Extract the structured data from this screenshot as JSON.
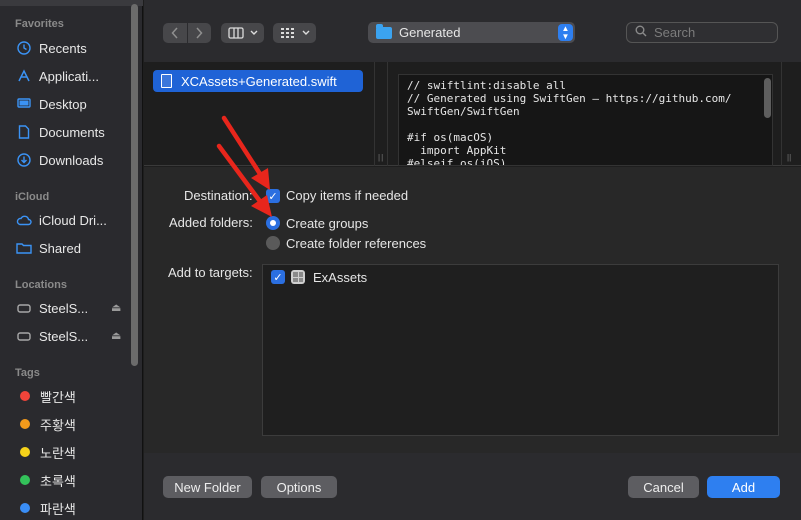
{
  "sidebar": {
    "sections": {
      "favorites": "Favorites",
      "icloud": "iCloud",
      "locations": "Locations",
      "tags": "Tags"
    },
    "favorites": [
      {
        "label": "Recents",
        "icon": "clock-icon"
      },
      {
        "label": "Applicati...",
        "icon": "applications-icon"
      },
      {
        "label": "Desktop",
        "icon": "desktop-icon"
      },
      {
        "label": "Documents",
        "icon": "document-icon"
      },
      {
        "label": "Downloads",
        "icon": "download-icon"
      }
    ],
    "icloud": [
      {
        "label": "iCloud Dri...",
        "icon": "cloud-icon"
      },
      {
        "label": "Shared",
        "icon": "shared-folder-icon"
      }
    ],
    "locations": [
      {
        "label": "SteelS...",
        "icon": "drive-icon"
      },
      {
        "label": "SteelS...",
        "icon": "drive-icon"
      }
    ],
    "tags": [
      {
        "label": "빨간색",
        "color": "#f0443a"
      },
      {
        "label": "주황색",
        "color": "#f39a1b"
      },
      {
        "label": "노란색",
        "color": "#f5d21a"
      },
      {
        "label": "초록색",
        "color": "#33c25a"
      },
      {
        "label": "파란색",
        "color": "#3a8ef6"
      }
    ]
  },
  "toolbar": {
    "path": "Generated",
    "search_placeholder": "Search"
  },
  "browser": {
    "selected_file": "XCAssets+Generated.swift",
    "preview_lines": [
      "// swiftlint:disable all",
      "// Generated using SwiftGen — https://github.com/",
      "SwiftGen/SwiftGen",
      "",
      "#if os(macOS)",
      "  import AppKit",
      "#elseif os(iOS)"
    ]
  },
  "options": {
    "destination_label": "Destination:",
    "copy_items": "Copy items if needed",
    "added_folders_label": "Added folders:",
    "create_groups": "Create groups",
    "create_folder_refs": "Create folder references",
    "add_to_targets_label": "Add to targets:",
    "target_name": "ExAssets"
  },
  "buttons": {
    "new_folder": "New Folder",
    "options": "Options",
    "cancel": "Cancel",
    "add": "Add"
  },
  "colors": {
    "accent": "#2e7ff0",
    "arrow": "#e8261c"
  }
}
